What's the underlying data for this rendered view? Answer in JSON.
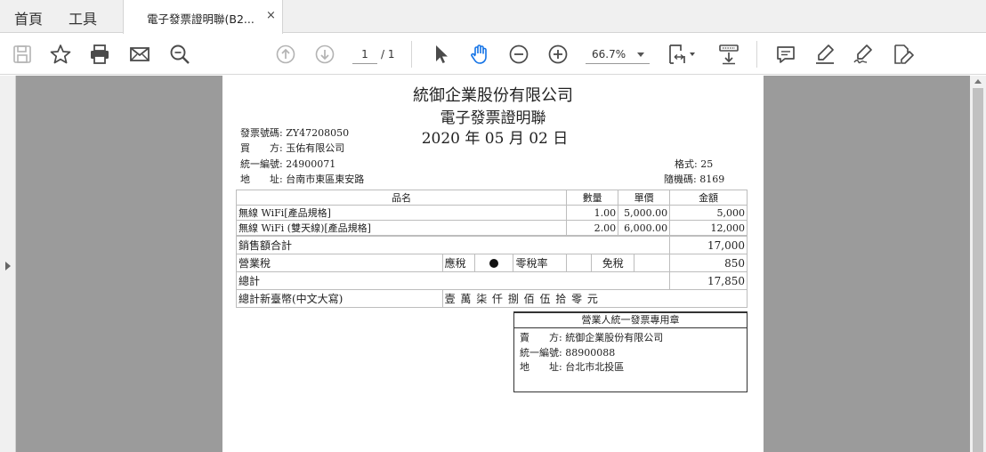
{
  "menu": {
    "home": "首頁",
    "tools": "工具"
  },
  "tab": {
    "title": "電子發票證明聯(B2...",
    "close": "×"
  },
  "toolbar": {
    "page_current": "1",
    "page_total": "/ 1",
    "zoom": "66.7%"
  },
  "colors": {
    "accent_hand": "#1473e6",
    "disabled": "#b3b3b3",
    "icon": "#4b4b4b"
  },
  "invoice": {
    "seller_company": "統御企業股份有限公司",
    "title": "電子發票證明聯",
    "date": "2020 年 05 月 02 日",
    "invoice_no_label": "發票號碼:",
    "invoice_no": "ZY47208050",
    "buyer_label": "買　　方:",
    "buyer": "玉佑有限公司",
    "tax_id_label": "統一編號:",
    "tax_id": "24900071",
    "address_label": "地　　址:",
    "address": "台南市東區東安路",
    "format_label": "格式:",
    "format": "25",
    "random_code_label": "隨機碼:",
    "random_code": "8169",
    "columns": {
      "item": "品名",
      "qty": "數量",
      "price": "單價",
      "amount": "金額"
    },
    "items": [
      {
        "name": "無線 WiFi[產品規格]",
        "qty": "1.00",
        "price": "5,000.00",
        "amount": "5,000"
      },
      {
        "name": "無線 WiFi (雙天線)[產品規格]",
        "qty": "2.00",
        "price": "6,000.00",
        "amount": "12,000"
      }
    ],
    "sales_total_label": "銷售額合計",
    "sales_total": "17,000",
    "tax_label": "營業稅",
    "taxable_label": "應稅",
    "zero_rate_label": "零稅率",
    "exempt_label": "免稅",
    "tax_amount": "850",
    "grand_total_label": "總計",
    "grand_total": "17,850",
    "chinese_total_label": "總計新臺幣(中文大寫)",
    "chinese_total": "壹 萬 柒 仟 捌 佰 伍 拾 零 元"
  },
  "stamp": {
    "header": "營業人統一發票專用章",
    "seller_label": "賣　　方:",
    "seller": "統御企業股份有限公司",
    "tax_id_label": "統一編號:",
    "tax_id": "88900088",
    "address_label": "地　　址:",
    "address": "台北市北投區"
  }
}
